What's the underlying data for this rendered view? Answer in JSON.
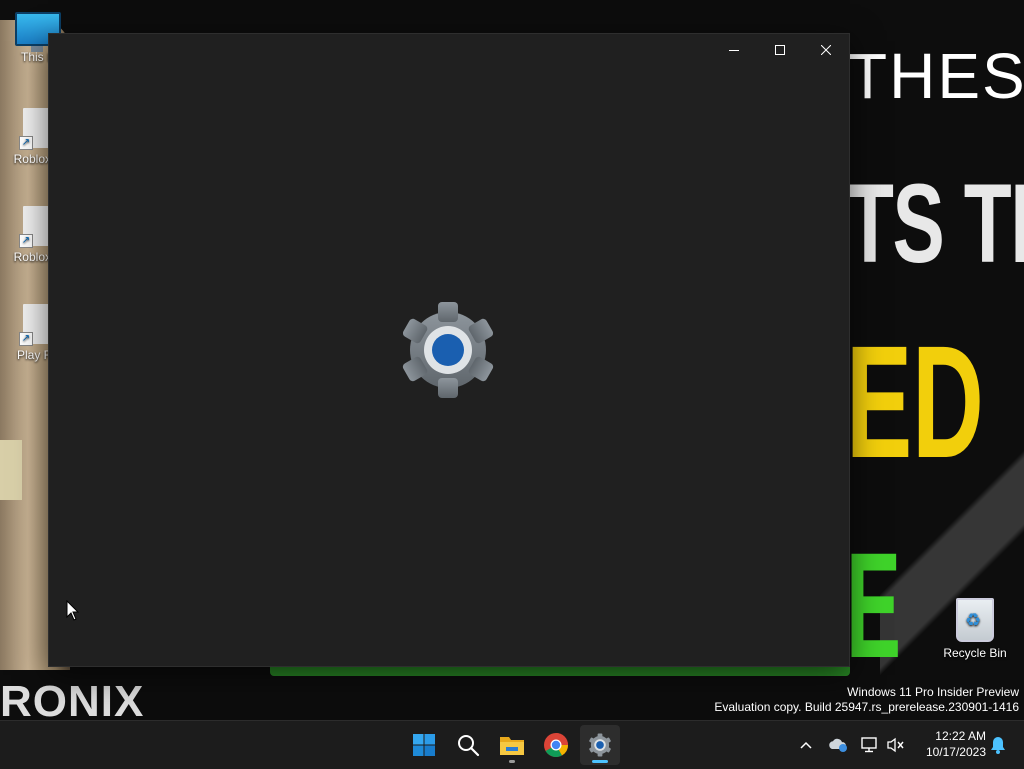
{
  "wallpaper": {
    "top_text": "THES",
    "mid_text": "TS TI",
    "yellow_text": "ED",
    "green_text": "E",
    "brand_text": "RONIX"
  },
  "desktop_icons": [
    {
      "label": "This P",
      "icon": "computer-icon"
    },
    {
      "label": "Roblox S",
      "icon": "shortcut-file-icon"
    },
    {
      "label": "Roblox P",
      "icon": "shortcut-file-icon"
    },
    {
      "label": "Play Ro",
      "icon": "shortcut-file-icon"
    },
    {
      "label": "Recycle Bin",
      "icon": "recycle-bin-icon"
    }
  ],
  "window": {
    "app": "Settings",
    "state": "loading splash",
    "accent": "#005fb8",
    "background": "#202020",
    "caption_buttons": [
      "minimize",
      "maximize",
      "close"
    ]
  },
  "watermark": {
    "line1": "Windows 11 Pro Insider Preview",
    "line2": "Evaluation copy. Build 25947.rs_prerelease.230901-1416"
  },
  "taskbar": {
    "apps": [
      {
        "name": "start",
        "icon": "windows-logo-icon",
        "active": false
      },
      {
        "name": "search",
        "icon": "search-icon",
        "active": false
      },
      {
        "name": "file-explorer",
        "icon": "folder-icon",
        "active": false,
        "running": true
      },
      {
        "name": "chrome",
        "icon": "chrome-icon",
        "active": false
      },
      {
        "name": "settings",
        "icon": "gear-icon",
        "active": true,
        "running": true
      }
    ],
    "tray_icons": [
      "chevron-up-icon",
      "onedrive-icon",
      "network-icon",
      "volume-muted-icon"
    ],
    "time": "12:22 AM",
    "date": "10/17/2023",
    "accent_indicator": "#4cc2ff"
  }
}
